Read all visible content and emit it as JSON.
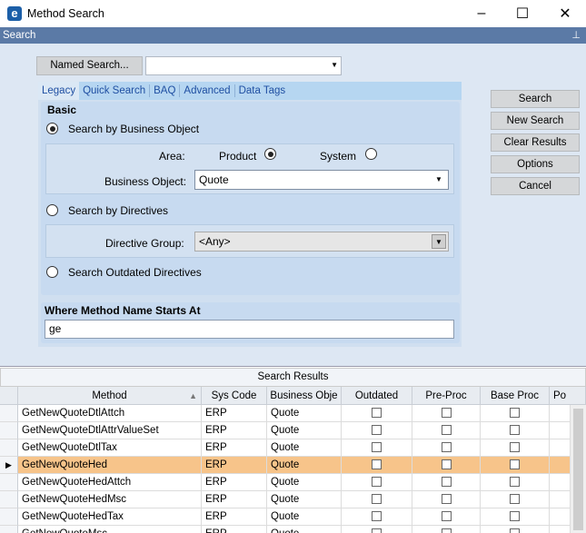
{
  "window": {
    "title": "Method Search",
    "icon": "epicor-e-icon",
    "min": "–",
    "max": "☐",
    "close": "✕"
  },
  "panel": {
    "title": "Search",
    "pin_icon": "pin-icon"
  },
  "named_search": {
    "label": "Named Search...",
    "value": ""
  },
  "tabs": [
    "Legacy",
    "Quick Search",
    "BAQ",
    "Advanced",
    "Data Tags"
  ],
  "basic": {
    "label": "Basic",
    "by_business_object": "Search by Business Object",
    "area_label": "Area:",
    "area_product": "Product",
    "area_system": "System",
    "business_object_label": "Business Object:",
    "business_object_value": "Quote",
    "by_directives": "Search by Directives",
    "directive_group_label": "Directive Group:",
    "directive_group_value": "<Any>",
    "outdated": "Search Outdated Directives"
  },
  "where": {
    "label": "Where Method Name Starts At",
    "value": "ge"
  },
  "buttons": {
    "search": "Search",
    "new_search": "New Search",
    "clear_results": "Clear Results",
    "options": "Options",
    "cancel": "Cancel"
  },
  "results": {
    "title": "Search Results",
    "columns": [
      "Method",
      "Sys Code",
      "Business Obje",
      "Outdated",
      "Pre-Proc",
      "Base Proc",
      "Po"
    ],
    "rows": [
      {
        "method": "GetNewQuoteDtlAttch",
        "sys": "ERP",
        "bo": "Quote"
      },
      {
        "method": "GetNewQuoteDtlAttrValueSet",
        "sys": "ERP",
        "bo": "Quote"
      },
      {
        "method": "GetNewQuoteDtlTax",
        "sys": "ERP",
        "bo": "Quote"
      },
      {
        "method": "GetNewQuoteHed",
        "sys": "ERP",
        "bo": "Quote"
      },
      {
        "method": "GetNewQuoteHedAttch",
        "sys": "ERP",
        "bo": "Quote"
      },
      {
        "method": "GetNewQuoteHedMsc",
        "sys": "ERP",
        "bo": "Quote"
      },
      {
        "method": "GetNewQuoteHedTax",
        "sys": "ERP",
        "bo": "Quote"
      },
      {
        "method": "GetNewQuoteMsc",
        "sys": "ERP",
        "bo": "Quote"
      }
    ],
    "selected_index": 3
  }
}
